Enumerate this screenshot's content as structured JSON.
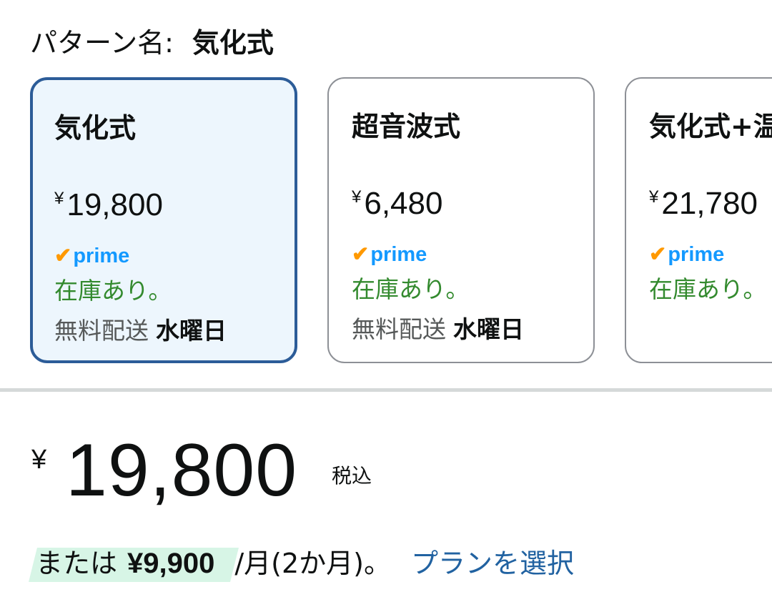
{
  "pattern": {
    "label": "パターン名:",
    "value": "気化式"
  },
  "options": [
    {
      "title": "気化式",
      "yen": "¥",
      "price": "19,800",
      "prime_label": "prime",
      "stock": "在庫あり。",
      "delivery_label": "無料配送",
      "delivery_day": "水曜日",
      "selected": true
    },
    {
      "title": "超音波式",
      "yen": "¥",
      "price": "6,480",
      "prime_label": "prime",
      "stock": "在庫あり。",
      "delivery_label": "無料配送",
      "delivery_day": "水曜日",
      "selected": false
    },
    {
      "title": "気化式+温",
      "yen": "¥",
      "price": "21,780",
      "prime_label": "prime",
      "stock": "在庫あり。",
      "selected": false
    }
  ],
  "price": {
    "yen": "¥",
    "amount": "19,800",
    "tax_note": "税込"
  },
  "installment": {
    "prefix": "または",
    "amount": "¥9,900",
    "period": "/月(2か月)。",
    "plan_link": "プランを選択"
  },
  "colors": {
    "selected_border": "#2c5c98",
    "selected_background": "#edf6fd",
    "stock_green": "#338a2e",
    "prime_blue": "#1399ff",
    "prime_check": "#ff9900",
    "link_blue": "#2162a1",
    "installment_highlight": "#d7f5e6"
  },
  "icons": {
    "prime_check": "check-icon"
  }
}
